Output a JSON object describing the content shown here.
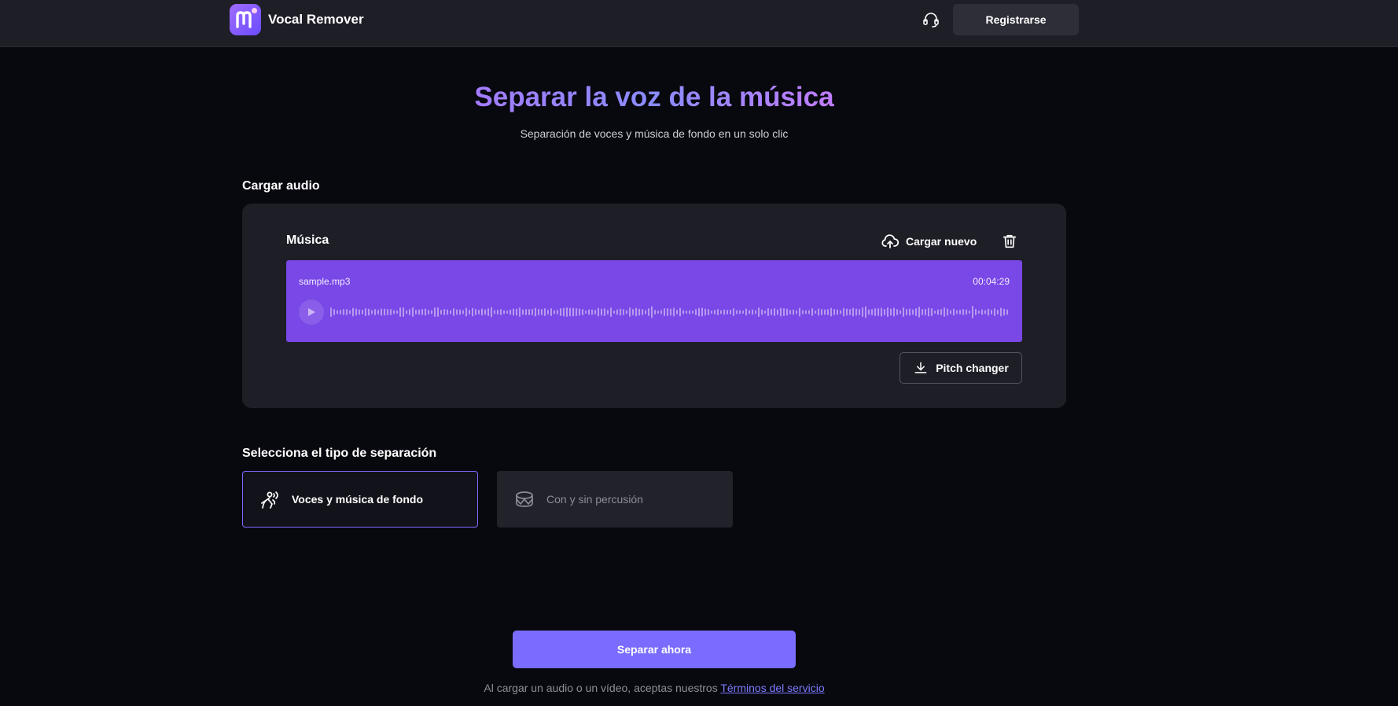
{
  "header": {
    "brand_name": "Vocal Remover",
    "register_label": "Registrarse"
  },
  "hero": {
    "title": "Separar la voz de la música",
    "subtitle": "Separación de voces y música de fondo en un solo clic"
  },
  "upload": {
    "section_label": "Cargar audio",
    "track_label": "Música",
    "upload_new_label": "Cargar nuevo",
    "file_name": "sample.mp3",
    "duration": "00:04:29",
    "pitch_changer_label": "Pitch changer"
  },
  "separation": {
    "section_label": "Selecciona el tipo de separación",
    "options": [
      {
        "label": "Voces y música de fondo",
        "selected": true,
        "icon": "singing-person-icon"
      },
      {
        "label": "Con y sin percusión",
        "selected": false,
        "icon": "drum-icon"
      }
    ]
  },
  "actions": {
    "separate_label": "Separar ahora",
    "terms_prefix": "Al cargar un audio o un vídeo, aceptas nuestros",
    "terms_link": "Términos del servicio"
  },
  "colors": {
    "accent": "#7a6cff",
    "player_bg": "#7a48e6",
    "page_bg": "#08080f",
    "card_bg": "#1e1e26"
  }
}
